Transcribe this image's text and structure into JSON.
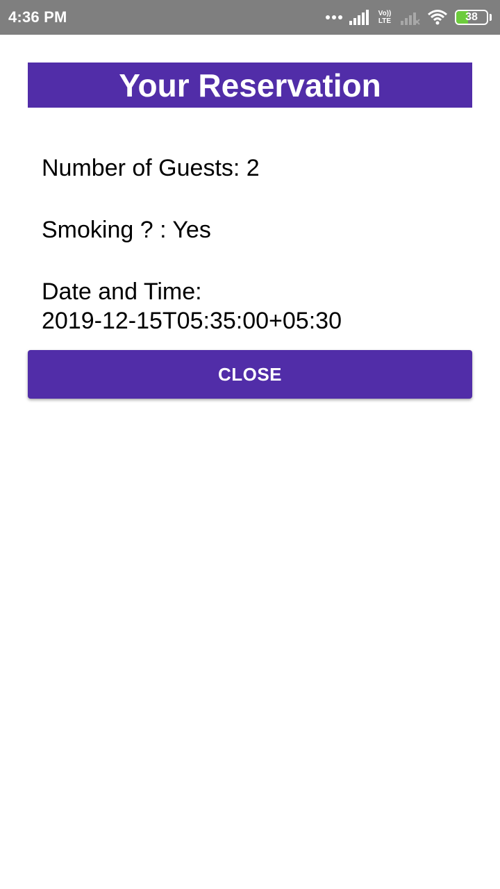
{
  "status_bar": {
    "time": "4:36 PM",
    "network_label": "Vo)) LTE",
    "battery_level": "38"
  },
  "reservation": {
    "title": "Your Reservation",
    "guests": "Number of Guests: 2",
    "smoking": "Smoking ? : Yes",
    "datetime_label": "Date and Time:",
    "datetime_value": "2019-12-15T05:35:00+05:30"
  },
  "actions": {
    "close_label": "CLOSE"
  },
  "colors": {
    "accent": "#512da8",
    "status_bar": "#7f7f7f",
    "battery": "#6dcc3d"
  }
}
